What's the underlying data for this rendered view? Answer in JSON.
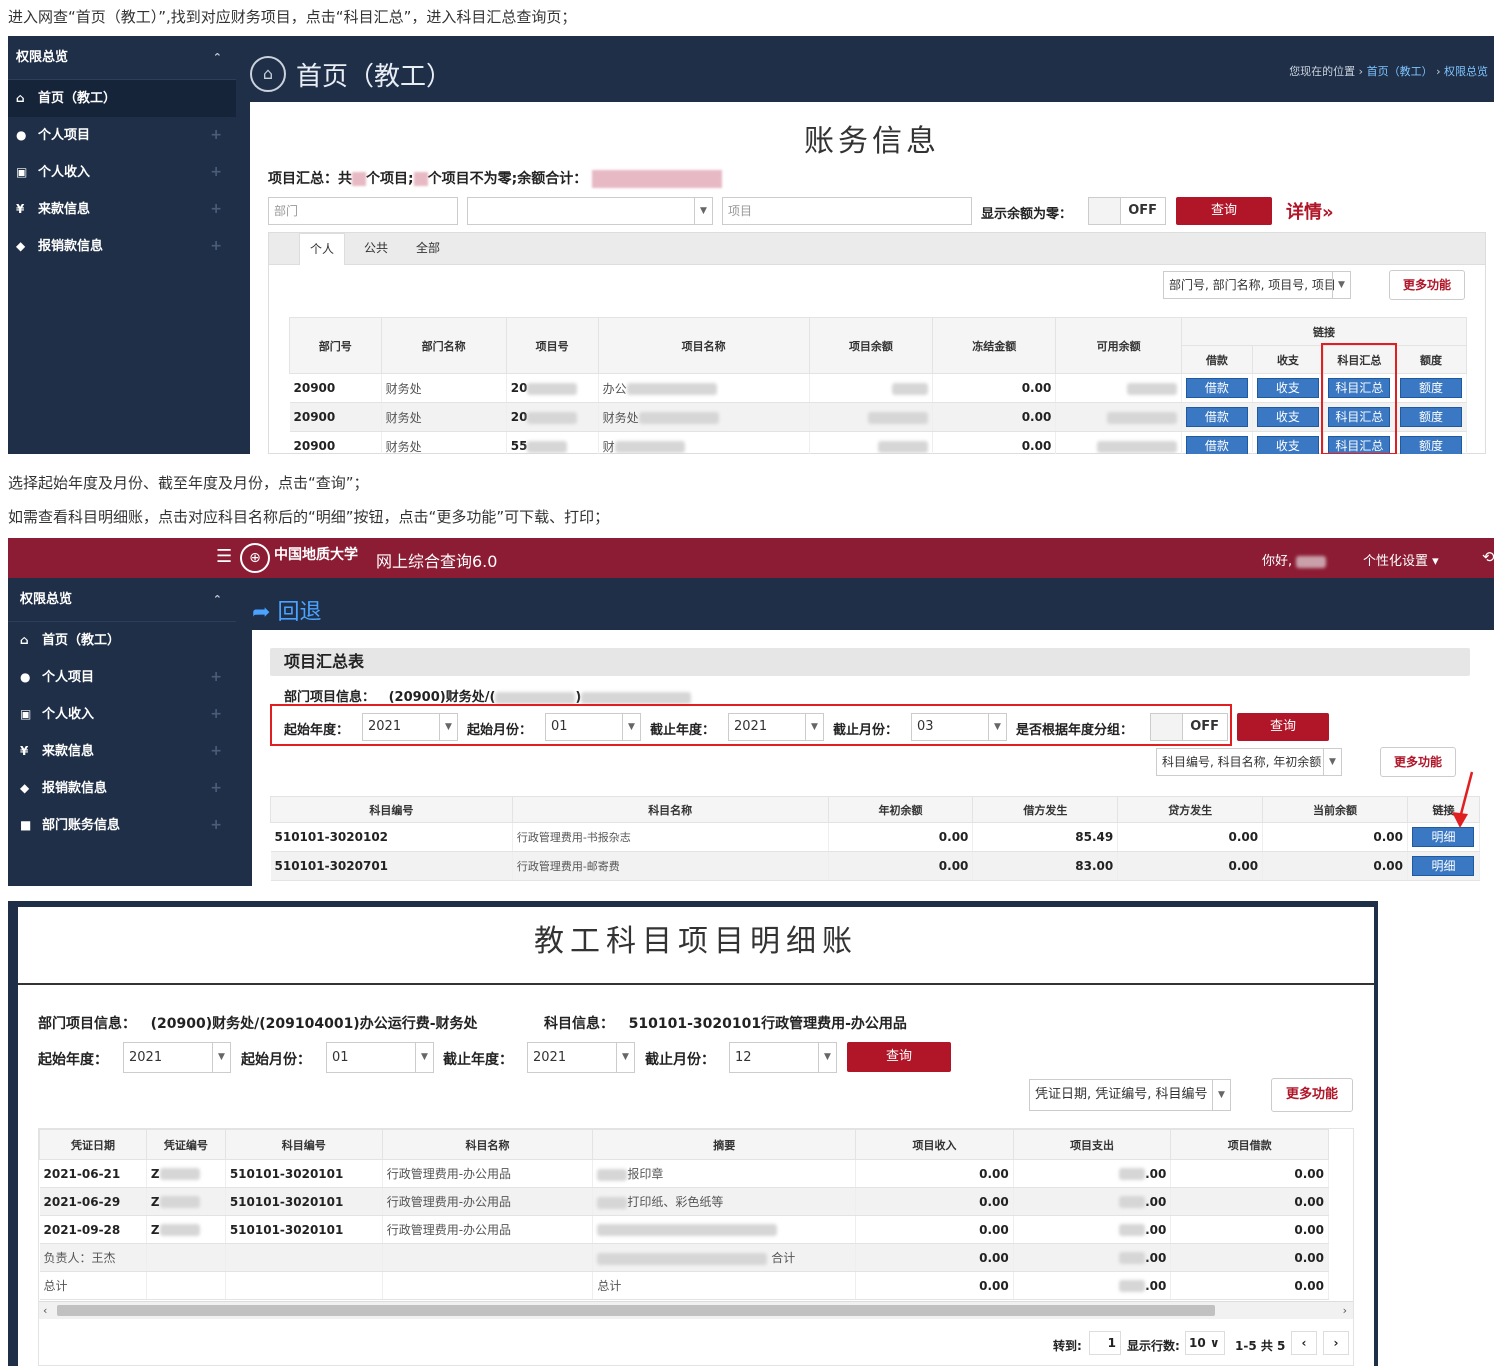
{
  "captions": {
    "c1": "进入网查“首页（教工）”,找到对应财务项目，点击“科目汇总”，进入科目汇总查询页；",
    "c2": "选择起始年度及月份、截至年度及月份，点击“查询”；",
    "c3": "如需查看科目明细账，点击对应科目名称后的“明细”按钮，点击“更多功能”可下载、打印；"
  },
  "shot1": {
    "sidebar": {
      "title": "权限总览",
      "items": [
        {
          "icon": "home-icon",
          "glyph": "⌂",
          "label": "首页（教工）"
        },
        {
          "icon": "user-icon",
          "glyph": "●",
          "label": "个人项目"
        },
        {
          "icon": "money-icon",
          "glyph": "▣",
          "label": "个人收入"
        },
        {
          "icon": "yen-icon",
          "glyph": "¥",
          "label": "来款信息"
        },
        {
          "icon": "tag-icon",
          "glyph": "◆",
          "label": "报销款信息"
        }
      ]
    },
    "page_title": "首页（教工）",
    "breadcrumb": {
      "prefix": "您现在的位置",
      "home": "首页（教工）",
      "current": "权限总览"
    },
    "panel_title": "账务信息",
    "summary": {
      "a": "项目汇总：共",
      "b": "个项目;",
      "c": "个项目不为零;余额合计："
    },
    "filters": {
      "dept_ph": "部门",
      "proj_ph": "项目",
      "zero_label": "显示余额为零：",
      "toggle": "OFF",
      "query": "查询",
      "detail": "详情»"
    },
    "tabs": [
      "个人",
      "公共",
      "全部"
    ],
    "columns_select": "部门号, 部门名称, 项目号, 项目",
    "more": "更多功能",
    "table": {
      "headers": [
        "部门号",
        "部门名称",
        "项目号",
        "项目名称",
        "项目余额",
        "冻结金额",
        "可用余额",
        "链接"
      ],
      "link_headers": [
        "借款",
        "收支",
        "科目汇总",
        "额度"
      ],
      "rows": [
        {
          "dept": "20900",
          "name": "财务处",
          "proj": "20",
          "pname": "办公",
          "frozen": "0.00"
        },
        {
          "dept": "20900",
          "name": "财务处",
          "proj": "20",
          "pname": "财务处",
          "frozen": "0.00"
        },
        {
          "dept": "20900",
          "name": "财务处",
          "proj": "55",
          "pname": "财",
          "frozen": "0.00"
        }
      ],
      "buttons": [
        "借款",
        "收支",
        "科目汇总",
        "额度"
      ]
    }
  },
  "shot2": {
    "app_title": "网上综合查询6.0",
    "logo_text": "中国地质大学",
    "greeting": "你好,",
    "settings": "个性化设置 ▾",
    "sidebar": {
      "title": "权限总览",
      "items": [
        {
          "icon": "home-icon",
          "glyph": "⌂",
          "label": "首页（教工）"
        },
        {
          "icon": "user-icon",
          "glyph": "●",
          "label": "个人项目"
        },
        {
          "icon": "money-icon",
          "glyph": "▣",
          "label": "个人收入"
        },
        {
          "icon": "yen-icon",
          "glyph": "¥",
          "label": "来款信息"
        },
        {
          "icon": "tag-icon",
          "glyph": "◆",
          "label": "报销款信息"
        },
        {
          "icon": "briefcase-icon",
          "glyph": "■",
          "label": "部门账务信息"
        }
      ]
    },
    "back": "回退",
    "section_title": "项目汇总表",
    "dept_info_label": "部门项目信息：",
    "dept_info_value": "(20900)财务处/(",
    "filters": {
      "start_year_label": "起始年度：",
      "start_year": "2021",
      "start_month_label": "起始月份：",
      "start_month": "01",
      "end_year_label": "截止年度：",
      "end_year": "2021",
      "end_month_label": "截止月份：",
      "end_month": "03",
      "group_label": "是否根据年度分组：",
      "toggle": "OFF",
      "query": "查询"
    },
    "columns_select": "科目编号, 科目名称, 年初余额",
    "more": "更多功能",
    "table": {
      "headers": [
        "科目编号",
        "科目名称",
        "年初余额",
        "借方发生",
        "贷方发生",
        "当前余额",
        "链接"
      ],
      "rows": [
        {
          "code": "510101-3020102",
          "name": "行政管理费用-书报杂志",
          "init": "0.00",
          "debit": "85.49",
          "credit": "0.00",
          "bal": "0.00",
          "link": "明细"
        },
        {
          "code": "510101-3020701",
          "name": "行政管理费用-邮寄费",
          "init": "0.00",
          "debit": "83.00",
          "credit": "0.00",
          "bal": "0.00",
          "link": "明细"
        }
      ]
    }
  },
  "shot3": {
    "title": "教工科目项目明细账",
    "dept_label": "部门项目信息：",
    "dept_value": "(20900)财务处/(209104001)办公运行费-财务处",
    "subj_label": "科目信息：",
    "subj_value": "510101-3020101行政管理费用-办公用品",
    "filters": {
      "start_year_label": "起始年度：",
      "start_year": "2021",
      "start_month_label": "起始月份：",
      "start_month": "01",
      "end_year_label": "截止年度：",
      "end_year": "2021",
      "end_month_label": "截止月份：",
      "end_month": "12",
      "query": "查询"
    },
    "columns_select": "凭证日期, 凭证编号, 科目编号",
    "more": "更多功能",
    "table": {
      "headers": [
        "凭证日期",
        "凭证编号",
        "科目编号",
        "科目名称",
        "摘要",
        "项目收入",
        "项目支出",
        "项目借款"
      ],
      "rows": [
        {
          "date": "2021-06-21",
          "no": "Z",
          "code": "510101-3020101",
          "name": "行政管理费用-办公用品",
          "memo": "报印章",
          "inc": "0.00",
          "exp": ".00",
          "loan": "0.00"
        },
        {
          "date": "2021-06-29",
          "no": "Z",
          "code": "510101-3020101",
          "name": "行政管理费用-办公用品",
          "memo": "打印纸、彩色纸等",
          "inc": "0.00",
          "exp": ".00",
          "loan": "0.00"
        },
        {
          "date": "2021-09-28",
          "no": "Z",
          "code": "510101-3020101",
          "name": "行政管理费用-办公用品",
          "memo": "",
          "inc": "0.00",
          "exp": ".00",
          "loan": "0.00"
        },
        {
          "date": "负责人：王杰",
          "no": "",
          "code": "",
          "name": "",
          "memo": "合计",
          "inc": "0.00",
          "exp": ".00",
          "loan": "0.00"
        },
        {
          "date": "总计",
          "no": "",
          "code": "",
          "name": "",
          "memo": "总计",
          "inc": "0.00",
          "exp": ".00",
          "loan": "0.00"
        }
      ]
    },
    "pager": {
      "goto_label": "转到:",
      "goto_value": "1",
      "rows_label": "显示行数:",
      "rows_value": "10 ∨",
      "range": "1-5 共 5",
      "prev": "‹",
      "next": "›"
    }
  }
}
